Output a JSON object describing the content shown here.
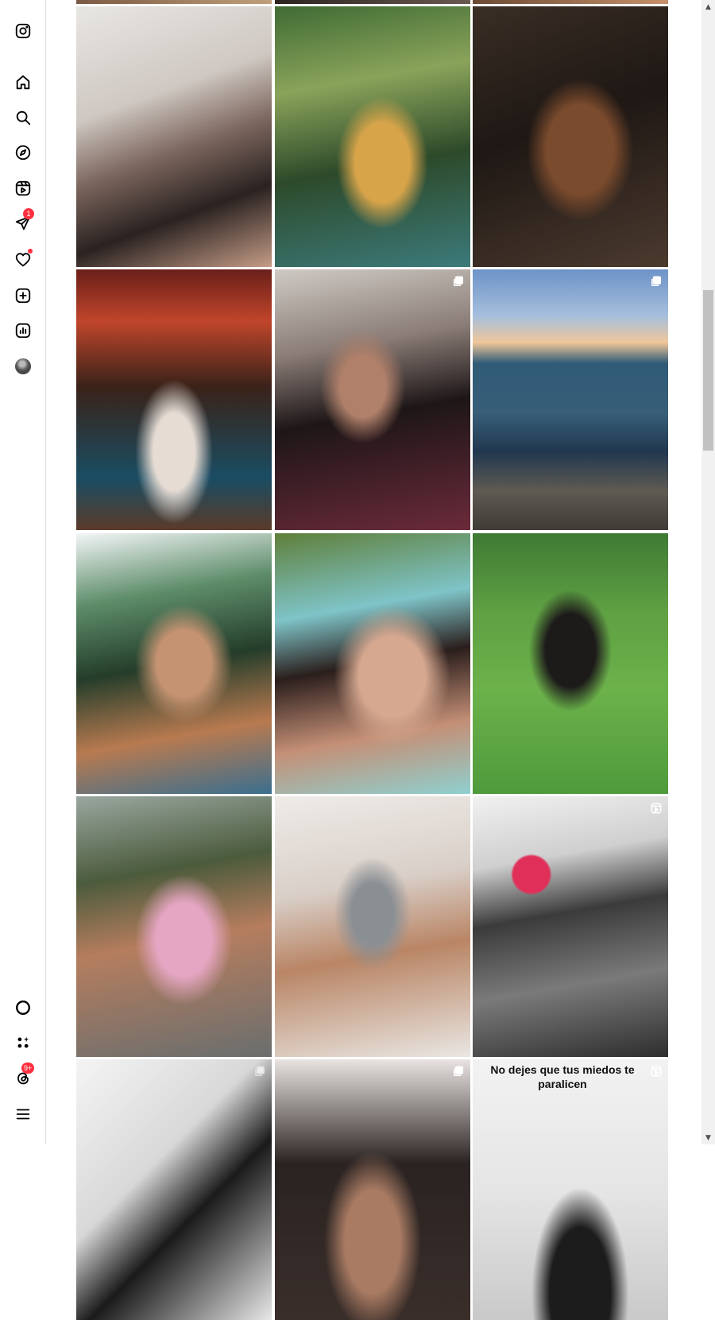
{
  "sidebar": {
    "items": [
      {
        "name": "instagram-logo-icon",
        "label": "Instagram"
      },
      {
        "name": "home-icon",
        "label": "Home"
      },
      {
        "name": "search-icon",
        "label": "Search"
      },
      {
        "name": "explore-icon",
        "label": "Explore"
      },
      {
        "name": "reels-icon",
        "label": "Reels"
      },
      {
        "name": "messages-icon",
        "label": "Messages",
        "badge": "1"
      },
      {
        "name": "notifications-icon",
        "label": "Notifications"
      },
      {
        "name": "create-icon",
        "label": "Create"
      },
      {
        "name": "dashboard-icon",
        "label": "Dashboard"
      },
      {
        "name": "profile-avatar",
        "label": "Profile"
      },
      {
        "name": "meta-ai-icon",
        "label": "Meta AI"
      },
      {
        "name": "also-from-meta-icon",
        "label": "Also from Meta"
      },
      {
        "name": "threads-icon",
        "label": "Threads",
        "badge": "9+"
      },
      {
        "name": "more-menu-icon",
        "label": "More"
      }
    ],
    "badge_color": "#ff3040"
  },
  "grid": {
    "posts": [
      {
        "id": "p1",
        "type": "photo"
      },
      {
        "id": "p2",
        "type": "photo"
      },
      {
        "id": "p3",
        "type": "photo"
      },
      {
        "id": "p4",
        "type": "photo"
      },
      {
        "id": "p5",
        "type": "carousel"
      },
      {
        "id": "p6",
        "type": "carousel"
      },
      {
        "id": "p7",
        "type": "photo"
      },
      {
        "id": "p8",
        "type": "photo"
      },
      {
        "id": "p9",
        "type": "photo"
      },
      {
        "id": "p10",
        "type": "photo"
      },
      {
        "id": "p11",
        "type": "photo"
      },
      {
        "id": "p12",
        "type": "reel"
      },
      {
        "id": "p13",
        "type": "carousel"
      },
      {
        "id": "p14",
        "type": "carousel"
      },
      {
        "id": "p15",
        "type": "reel",
        "caption": "No dejes que tus miedos te paralicen"
      }
    ]
  },
  "scrollbar": {
    "up_arrow": "▲",
    "down_arrow": "▼"
  }
}
